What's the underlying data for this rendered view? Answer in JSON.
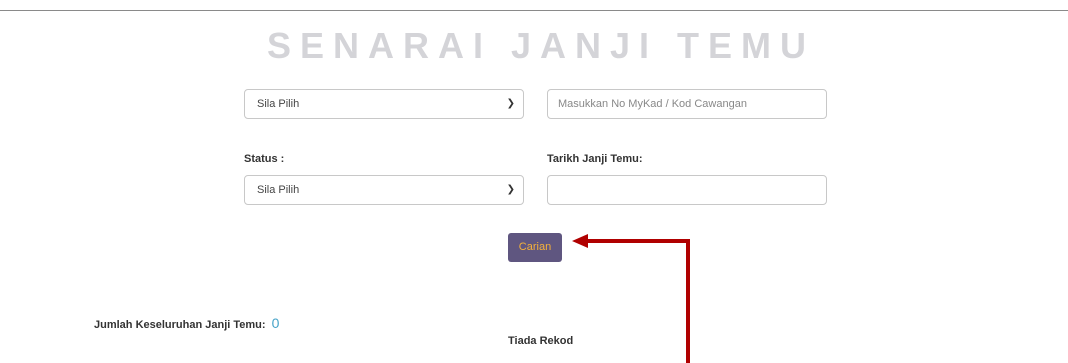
{
  "page": {
    "title": "SENARAI JANJI TEMU"
  },
  "filters": {
    "category_select": {
      "value": "Sila Pilih"
    },
    "search_input": {
      "placeholder": "Masukkan No MyKad / Kod Cawangan"
    },
    "status_label": "Status :",
    "status_select": {
      "value": "Sila Pilih"
    },
    "date_label": "Tarikh Janji Temu:",
    "date_input": {
      "value": ""
    }
  },
  "actions": {
    "search_button_label": "Carian"
  },
  "results": {
    "total_label": "Jumlah Keseluruhan Janji Temu:",
    "total_count": "0",
    "empty_message": "Tiada Rekod"
  },
  "colors": {
    "title": "#d4d4d8",
    "button_bg": "#5f5680",
    "button_text": "#f5b13a",
    "count_text": "#46a3c8",
    "annotation_arrow": "#b00000"
  }
}
